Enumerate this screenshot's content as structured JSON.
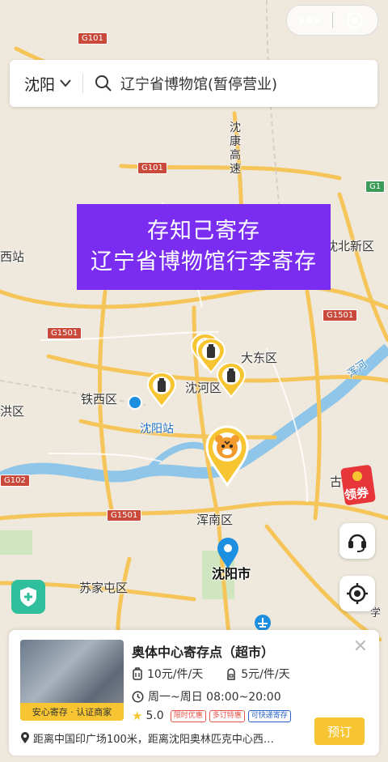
{
  "map": {
    "labels": {
      "shenbei": "沈北新区",
      "dadong": "大东区",
      "shenhe": "沈河区",
      "tiexi": "铁西区",
      "shenyang_station": "沈阳站",
      "hunnan": "浑南区",
      "shenyang_city": "沈阳市",
      "sujiatun": "苏家屯区",
      "west_station": "西站",
      "yuhong": "洪区",
      "hun_river": "浑河",
      "shenkang": "沈康高速",
      "xue": "学",
      "gu": "古"
    },
    "roads": {
      "g101_a": "G101",
      "g101_b": "G101",
      "g1": "G1",
      "g1501_a": "G1501",
      "g1501_b": "G1501",
      "g1501_c": "G1501",
      "g102": "G102"
    },
    "colors": {
      "water": "#8ec5e8",
      "road": "#f5c55a",
      "background": "#efe9dd",
      "pin": "#f6c531",
      "location": "#1d8fe1"
    }
  },
  "capsule": {
    "more_icon": "more-dots-icon",
    "close_icon": "target-circle-icon"
  },
  "search": {
    "city": "沈阳",
    "query": "辽宁省博物馆(暂停营业)"
  },
  "banner": {
    "line1": "存知己寄存",
    "line2": "辽宁省博物馆行李寄存"
  },
  "coupon": {
    "label": "领券"
  },
  "card": {
    "title": "奥体中心寄存点（超市）",
    "thumb_tag": "安心寄存 · 认证商家",
    "price_luggage": "10元/件/天",
    "price_bag": "5元/件/天",
    "hours": "周一~周日 08:00~20:00",
    "rating": "5.0",
    "tags": [
      "限时优惠",
      "多订特惠",
      "可快递寄存"
    ],
    "address": "距离中国印广场100米，距离沈阳奥林匹克中心西…",
    "book_label": "预订",
    "accent": "#f6c531"
  }
}
